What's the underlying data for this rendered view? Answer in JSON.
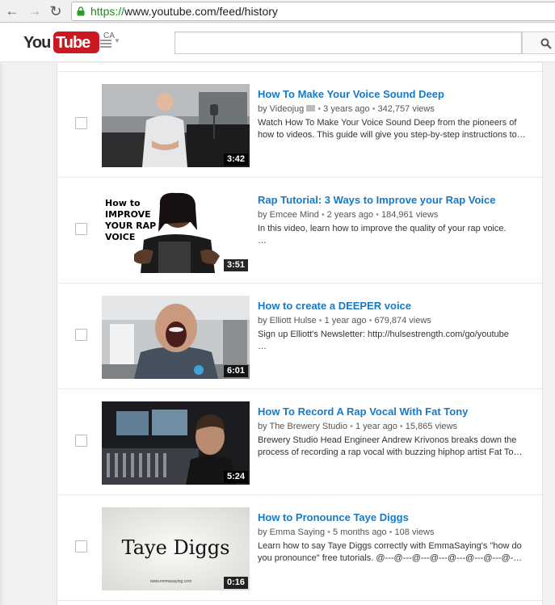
{
  "browser": {
    "url_scheme": "https://",
    "url_rest": "www.youtube.com/feed/history"
  },
  "header": {
    "logo_you": "You",
    "logo_tube": "Tube",
    "country": "CA",
    "search_placeholder": ""
  },
  "videos": [
    {
      "title": "How To Make Your Voice Sound Deep",
      "channel": "by Videojug",
      "verified": true,
      "age": "3 years ago",
      "views": "342,757 views",
      "desc_line1": "Watch How To Make Your Voice Sound Deep from the pioneers of",
      "desc_line2": "how to videos. This guide will give you step-by-step instructions to…",
      "duration": "3:42"
    },
    {
      "title": "Rap Tutorial: 3 Ways to Improve your Rap Voice",
      "channel": "by Emcee Mind",
      "verified": false,
      "age": "2 years ago",
      "views": "184,961 views",
      "desc_line1": "In this video, learn how to improve the quality of your rap voice.",
      "desc_line2": "…",
      "duration": "3:51",
      "thumb_text": [
        "How to",
        "IMPROVE",
        "YOUR RAP",
        "VOICE"
      ]
    },
    {
      "title": "How to create a DEEPER voice",
      "channel": "by Elliott Hulse",
      "verified": false,
      "age": "1 year ago",
      "views": "679,874 views",
      "desc_line1": "Sign up Elliott's Newsletter: http://hulsestrength.com/go/youtube",
      "desc_line2": "…",
      "duration": "6:01"
    },
    {
      "title": "How To Record A Rap Vocal With Fat Tony",
      "channel": "by The Brewery Studio",
      "verified": false,
      "age": "1 year ago",
      "views": "15,865 views",
      "desc_line1": "Brewery Studio Head Engineer Andrew Krivonos breaks down the",
      "desc_line2": "process of recording a rap vocal with buzzing hiphop artist Fat To…",
      "duration": "5:24"
    },
    {
      "title": "How to Pronounce Taye Diggs",
      "channel": "by Emma Saying",
      "verified": false,
      "age": "5 months ago",
      "views": "108 views",
      "desc_line1": "Learn how to say Taye Diggs correctly with EmmaSaying's \"how do",
      "desc_line2": "you pronounce\" free tutorials. @---@---@---@---@---@---@---@-…",
      "duration": "0:16",
      "thumb_text": [
        "Taye Diggs",
        "www.emmasaying.com"
      ]
    }
  ]
}
